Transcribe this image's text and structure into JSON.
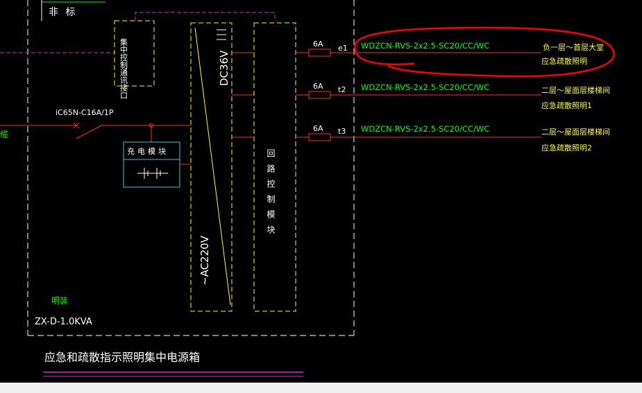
{
  "header": {
    "label": "非  标"
  },
  "cabinet": {
    "model": "ZX-D-1.0KVA",
    "mount": "明装",
    "title": "应急和疏散指示照明集中电源箱"
  },
  "monitor_module": {
    "label": "集中控制通讯接口"
  },
  "breaker": {
    "label": "iC65N-C16A/1P"
  },
  "left_cable": {
    "label": "缆"
  },
  "charger": {
    "label": "充电模块"
  },
  "converter": {
    "dc_label": "DC36V",
    "ac_label": "~AC220V"
  },
  "output_module": {
    "label": "回路控制模块"
  },
  "circuits": [
    {
      "id": "e1",
      "fuse": "6A",
      "cable": "WDZCN-RVS-2x2.5-SC20/CC/WC",
      "dest_line1": "负一层～首层大堂",
      "dest_line2": "应急疏散照明",
      "highlighted": true
    },
    {
      "id": "t2",
      "fuse": "6A",
      "cable": "WDZCN-RVS-2x2.5-SC20/CC/WC",
      "dest_line1": "二层～屋面层楼梯间",
      "dest_line2": "应急疏散照明1",
      "highlighted": false
    },
    {
      "id": "t3",
      "fuse": "6A",
      "cable": "WDZCN-RVS-2x2.5-SC20/CC/WC",
      "dest_line1": "二层～屋面层楼梯间",
      "dest_line2": "应急疏散照明2",
      "highlighted": false
    }
  ],
  "colors": {
    "background": "#000000",
    "frame": "#ffffff",
    "module": "#ffff00",
    "wire": "#ff2a2a",
    "cable_text": "#00ff00",
    "dest_text": "#ffff00",
    "comm": "#cc33cc",
    "charger": "#33cccc",
    "highlight": "#ff0000"
  }
}
